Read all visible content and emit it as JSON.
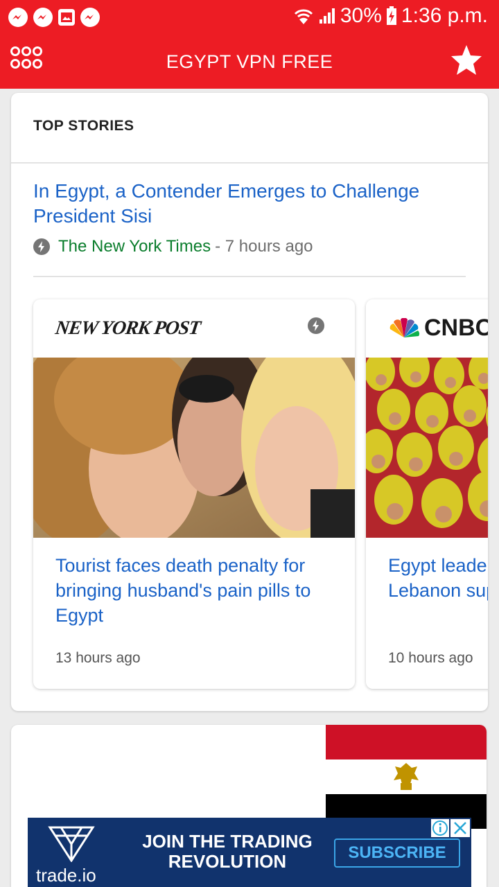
{
  "status_bar": {
    "battery": "30%",
    "time": "1:36 p.m.",
    "left_icons": [
      "messenger-icon",
      "messenger-icon",
      "image-icon",
      "messenger-icon"
    ],
    "right_icons": [
      "wifi-icon",
      "signal-icon",
      "battery-charging-icon"
    ]
  },
  "app_bar": {
    "title": "EGYPT VPN FREE",
    "menu_icon": "grid-menu-icon",
    "star_icon": "star-icon",
    "color": "#ed1c24"
  },
  "top_stories": {
    "header": "TOP STORIES",
    "main_story": {
      "headline": "In Egypt, a Contender Emerges to Challenge President Sisi",
      "source": "The New York Times",
      "time": "- 7 hours ago"
    },
    "cards": [
      {
        "publisher": "NEW YORK POST",
        "title": "Tourist faces death penalty for bringing husband's pain pills to Egypt",
        "time": "13 hours ago"
      },
      {
        "publisher": "CNBC",
        "title": "Egypt leader tensions flare and Lebanon support mor",
        "time": "10 hours ago"
      }
    ]
  },
  "ad": {
    "brand": "trade.io",
    "headline": "JOIN THE TRADING REVOLUTION",
    "cta": "SUBSCRIBE"
  }
}
